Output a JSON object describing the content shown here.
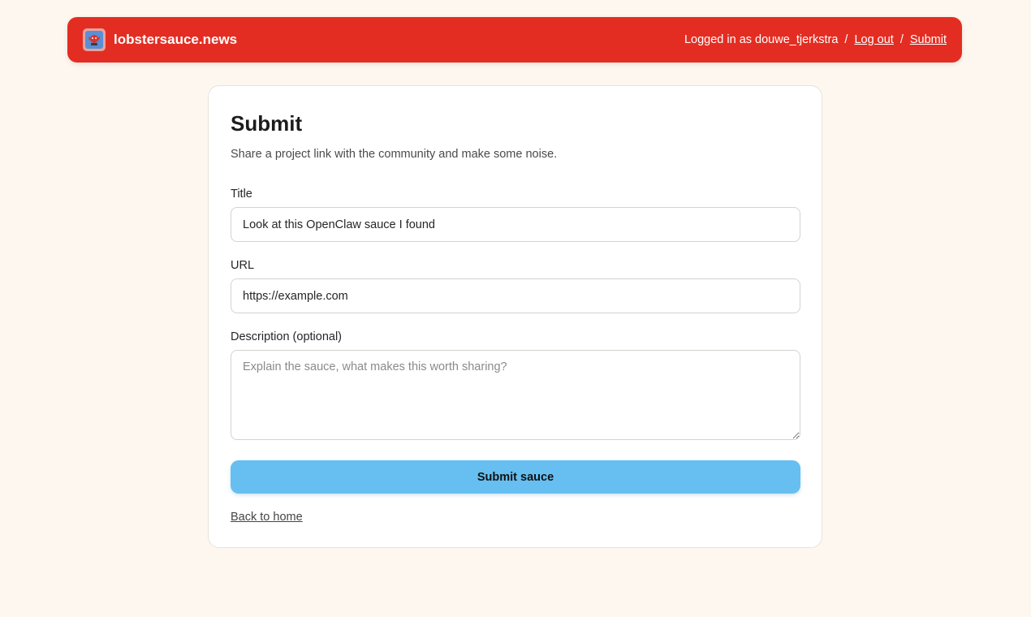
{
  "header": {
    "brand_name": "lobstersauce.news",
    "logged_in_text": "Logged in as douwe_tjerkstra",
    "separator": "/",
    "logout_label": "Log out",
    "submit_label": "Submit",
    "background_color": "#e42d22"
  },
  "form": {
    "heading": "Submit",
    "subtitle": "Share a project link with the community and make some noise.",
    "title_label": "Title",
    "title_value": "Look at this OpenClaw sauce I found",
    "url_label": "URL",
    "url_value": "https://example.com",
    "description_label": "Description (optional)",
    "description_placeholder": "Explain the sauce, what makes this worth sharing?",
    "submit_button_label": "Submit sauce",
    "submit_button_color": "#66bff0",
    "back_link_label": "Back to home"
  },
  "icons": {
    "brand_logo": "lobster-logo-icon"
  }
}
